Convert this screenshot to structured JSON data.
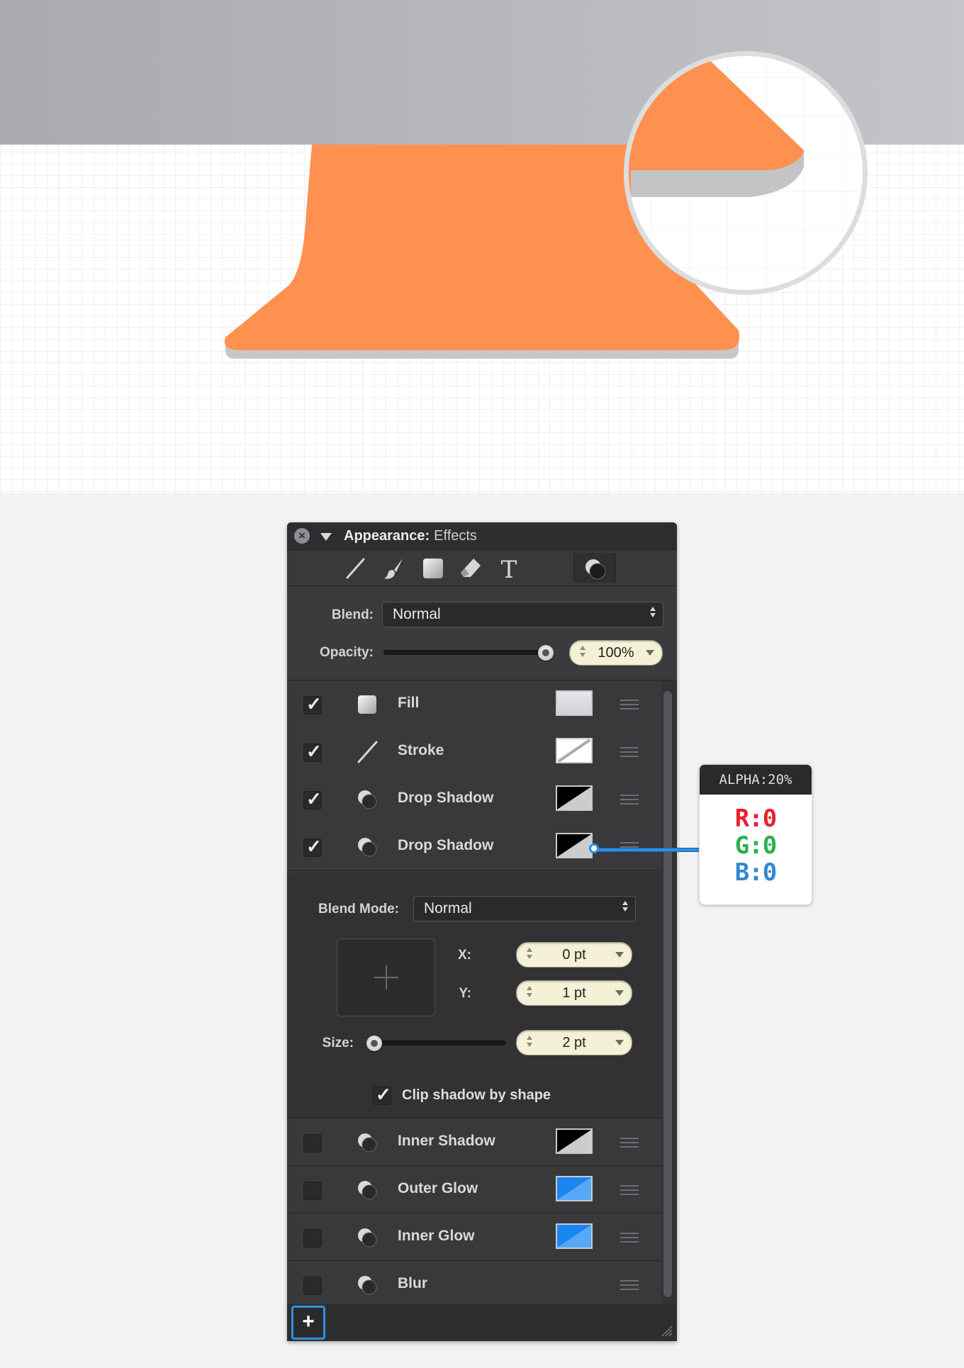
{
  "panel": {
    "title": "Appearance:",
    "subtitle": "Effects",
    "tools": [
      {
        "icon": "line-tool-icon"
      },
      {
        "icon": "brush-tool-icon"
      },
      {
        "icon": "fill-tool-icon"
      },
      {
        "icon": "eraser-tool-icon"
      },
      {
        "icon": "text-tool-icon",
        "glyph": "T"
      },
      {
        "icon": "effects-tool-icon",
        "active": true
      }
    ],
    "blend_label": "Blend:",
    "blend_value": "Normal",
    "opacity_label": "Opacity:",
    "opacity_value": "100%",
    "opacity_level": 1.0,
    "effects": [
      {
        "name": "Fill",
        "checked": true,
        "icon": "fill-icon",
        "swatch": "fill"
      },
      {
        "name": "Stroke",
        "checked": true,
        "icon": "stroke-icon",
        "swatch": "stroke"
      },
      {
        "name": "Drop Shadow",
        "checked": true,
        "icon": "shadow-icon",
        "swatch": "shadow-black"
      },
      {
        "name": "Drop Shadow",
        "checked": true,
        "icon": "shadow-icon",
        "swatch": "shadow-black"
      },
      {
        "name": "Inner Shadow",
        "checked": false,
        "icon": "shadow-icon",
        "swatch": "shadow-black"
      },
      {
        "name": "Outer Glow",
        "checked": false,
        "icon": "shadow-icon",
        "swatch": "glow-blue"
      },
      {
        "name": "Inner Glow",
        "checked": false,
        "icon": "shadow-icon",
        "swatch": "glow-blue"
      },
      {
        "name": "Blur",
        "checked": false,
        "icon": "shadow-icon",
        "swatch": null
      }
    ],
    "shadow_detail": {
      "blend_mode_label": "Blend Mode:",
      "blend_mode_value": "Normal",
      "x_label": "X:",
      "x_value": "0 pt",
      "y_label": "Y:",
      "y_value": "1 pt",
      "size_label": "Size:",
      "size_value": "2 pt",
      "size_level": 0.0,
      "clip_label": "Clip shadow by shape",
      "clip_checked": true,
      "checkmark": "✓"
    },
    "add_button": "+"
  },
  "tooltip": {
    "header": "ALPHA:20%",
    "r": "R:0",
    "g": "G:0",
    "b": "B:0"
  },
  "colors": {
    "shape_orange": "#fe914f",
    "stroke_gray": "#a9aaaf",
    "grid_line": "#e2e2e4",
    "accent_blue": "#2e8fe6",
    "tooltip_r": "#e8212c",
    "tooltip_g": "#2fb04a",
    "tooltip_b": "#2f88d6",
    "glow_blue": "#1a86f2"
  }
}
